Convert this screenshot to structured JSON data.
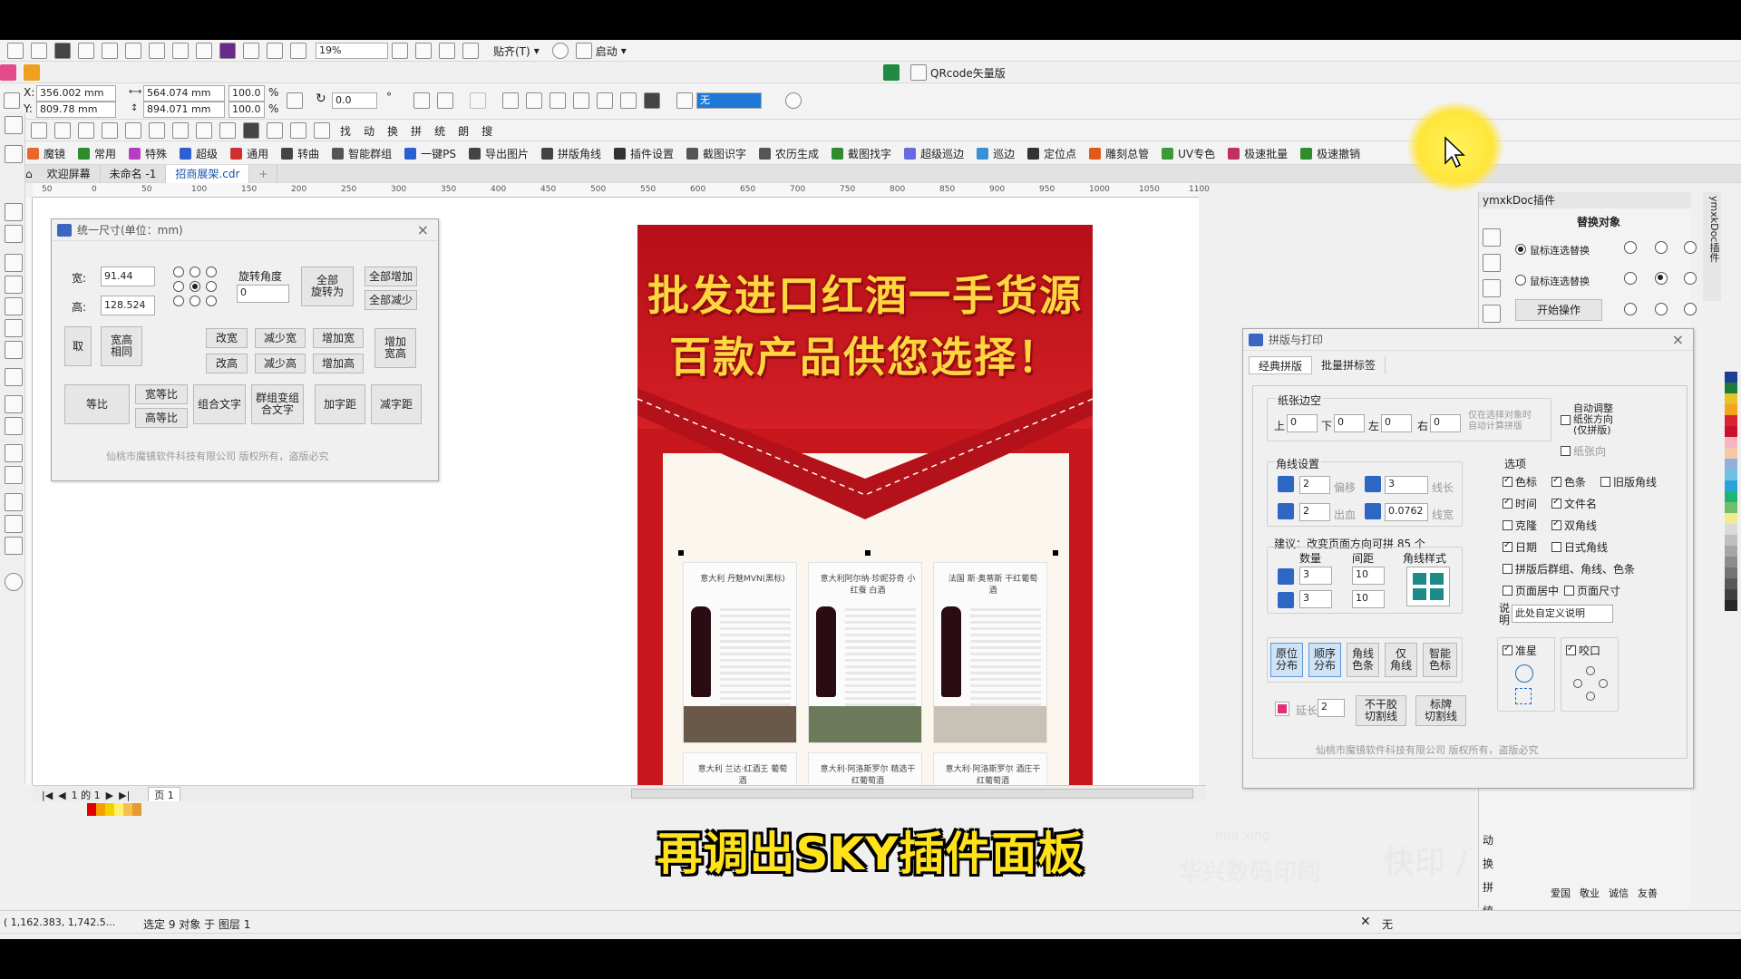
{
  "toolbar_top": {
    "zoom": "19%",
    "snap": "贴齐(T)",
    "launch": "启动"
  },
  "qrcode_label": "QRcode矢量版",
  "properties": {
    "x_label": "X:",
    "x": "356.002 mm",
    "y_label": "Y:",
    "y": "809.78 mm",
    "w": "564.074 mm",
    "h": "894.071 mm",
    "scale_w": "100.0",
    "scale_h": "100.0",
    "percent": "%",
    "angle": "0.0",
    "degree": "°",
    "outline": "无"
  },
  "toolbox_text_tools": [
    "找",
    "动",
    "换",
    "拼",
    "统",
    "朗",
    "搜"
  ],
  "plugin_bar": [
    "魔镜",
    "常用",
    "特殊",
    "超级",
    "通用",
    "转曲",
    "智能群组",
    "一键PS",
    "导出图片",
    "拼版角线",
    "插件设置",
    "截图识字",
    "农历生成",
    "截图找字",
    "超级巡边",
    "巡边",
    "定位点",
    "雕刻总管",
    "UV专色",
    "极速批量",
    "极速撤销"
  ],
  "plugin_colors": [
    "#e8672a",
    "#2e8b2e",
    "#b43fc4",
    "#2c5fd0",
    "#d03030",
    "#444444",
    "#555555",
    "#2c5fd0",
    "#444444",
    "#444444",
    "#333333",
    "#555555",
    "#555555",
    "#2e8b2e",
    "#6a6ae0",
    "#3a90d8",
    "#333333",
    "#e05a1a",
    "#3a9a3a",
    "#c03060",
    "#2e8b2e"
  ],
  "doc_tabs": {
    "welcome": "欢迎屏幕",
    "untitled": "未命名 -1",
    "active": "招商展架.cdr",
    "add": "+"
  },
  "ruler": [
    "50",
    "0",
    "50",
    "100",
    "150",
    "200",
    "250",
    "300",
    "350",
    "400",
    "450",
    "500",
    "550",
    "600",
    "650",
    "700",
    "750",
    "800",
    "850",
    "900",
    "950",
    "1000",
    "1050",
    "1100"
  ],
  "size_panel": {
    "title": "统一尺寸(单位：mm)",
    "width_label": "宽:",
    "width": "91.44",
    "height_label": "高:",
    "height": "128.524",
    "rotate_label": "旋转角度",
    "rotate": "0",
    "btn_all_rotate": "全部\n旋转为",
    "btn_all_add": "全部增加",
    "btn_all_sub": "全部减少",
    "btn_take": "取",
    "btn_same_wh": "宽高\n相同",
    "btn_w_change": "改宽",
    "btn_w_reduce": "减少宽",
    "btn_w_add": "增加宽",
    "btn_wh_add": "增加\n宽高",
    "btn_h_change": "改高",
    "btn_h_reduce": "减少高",
    "btn_h_add": "增加高",
    "btn_ratio": "等比",
    "btn_w_ratio": "宽等比",
    "btn_h_ratio": "高等比",
    "btn_combine_text": "组合文字",
    "btn_group_text": "群组变组\n合文字",
    "btn_add_spacing": "加字距",
    "btn_sub_spacing": "减字距",
    "footer": "仙桃市魔镜软件科技有限公司 版权所有，盗版必究"
  },
  "poster": {
    "line1": "批发进口红酒一手货源",
    "line2": "百款产品供您选择！",
    "cards": [
      "意大利 丹魅MVN(黑标)",
      "意大利阿尔纳·珍妮芬奇 小红蚕 白酒",
      "法国 斯·奥蒂斯 干红葡萄酒",
      "意大利 兰达·红酒王 葡萄酒",
      "意大利·阿洛斯罗尔 精选干红葡萄酒",
      "意大利·阿洛斯罗尔 酒庄干红葡萄酒"
    ]
  },
  "right_panel": {
    "header": "ymxkDoc插件",
    "replace_title": "替换对象",
    "option1": "鼠标连选替换",
    "option2": "鼠标连选替换",
    "start": "开始操作",
    "vertical_label": "ymxkDoc插件"
  },
  "print_panel": {
    "title": "拼版与打印",
    "tab1": "经典拼版",
    "tab2": "批量拼标签",
    "margin_group": "纸张边空",
    "top": "上",
    "top_v": "0",
    "bottom": "下",
    "bottom_v": "0",
    "left": "左",
    "left_v": "0",
    "right": "右",
    "right_v": "0",
    "margin_hint": "仅在选择对象时\n自动计算拼版",
    "auto_adjust": "自动调整\n纸张方向\n(仅拼版)",
    "paper_dir": "纸张向",
    "corner_group": "角线设置",
    "offset_v": "2",
    "offset": "偏移",
    "line_len_v": "3",
    "line_len": "线长",
    "bleed_v": "2",
    "bleed": "出血",
    "line_w_v": "0.0762",
    "line_w": "线宽",
    "suggest": "建议：改变页面方向可拼 85 个",
    "qty": "数量",
    "spacing": "间距",
    "corner_style": "角线样式",
    "qty_x": "3",
    "gap_x": "10",
    "qty_y": "3",
    "gap_y": "10",
    "options_title": "选项",
    "opt_color_mark": "色标",
    "opt_color_bar": "色条",
    "opt_old_corner": "旧版角线",
    "opt_time": "时间",
    "opt_filename": "文件名",
    "opt_clone": "克隆",
    "opt_double": "双角线",
    "opt_date": "日期",
    "opt_jp": "日式角线",
    "opt_group_after": "拼版后群组、角线、色条",
    "opt_center": "页面居中",
    "opt_pagesize": "页面尺寸",
    "desc_label": "说明",
    "desc_value": "此处自定义说明",
    "btn_orig": "原位\n分布",
    "btn_seq": "顺序\n分布",
    "btn_corner_color": "角线\n色条",
    "btn_only_corner": "仅\n角线",
    "btn_smart_color": "智能\n色标",
    "reg": "准星",
    "bite": "咬口",
    "extend": "延长",
    "extend_v": "2",
    "btn_no_glue": "不干胶\n切割线",
    "btn_label_cut": "标牌\n切割线",
    "footer": "仙桃市魔镜软件科技有限公司 版权所有，盗版必究"
  },
  "right_side_text": [
    "动",
    "换",
    "拼",
    "统"
  ],
  "right_bottom_links": [
    "爱国",
    "敬业",
    "诚信",
    "友善"
  ],
  "status": {
    "coords": "( 1,162.383, 1,742.5...",
    "selection": "选定 9 对象 于 图层 1",
    "fill": "无",
    "page_info": "1 的 1",
    "page_tab": "页 1"
  },
  "watermark": {
    "brand": "华兴数码印刷",
    "en": "hua xing",
    "slogan": "快印 / 印刷 / 广告"
  },
  "subtitle": "再调出SKY插件面板",
  "palette_colors": [
    "#1c3f94",
    "#1f7a3a",
    "#e5c32b",
    "#f2a41a",
    "#d8262e",
    "#c8102e",
    "#f7b5c4",
    "#f5c8a8",
    "#8fb1dc",
    "#6fc0e6",
    "#2aa3d8",
    "#21b573",
    "#6cc06c",
    "#f2eb8c",
    "#d9d9d9",
    "#bfbfbf",
    "#a6a6a6",
    "#8c8c8c",
    "#737373",
    "#595959",
    "#404040",
    "#262626"
  ],
  "doc_palette": [
    "#e00000",
    "#f5a000",
    "#f5d000",
    "#fff06a",
    "#f5c050",
    "#e89a30"
  ]
}
